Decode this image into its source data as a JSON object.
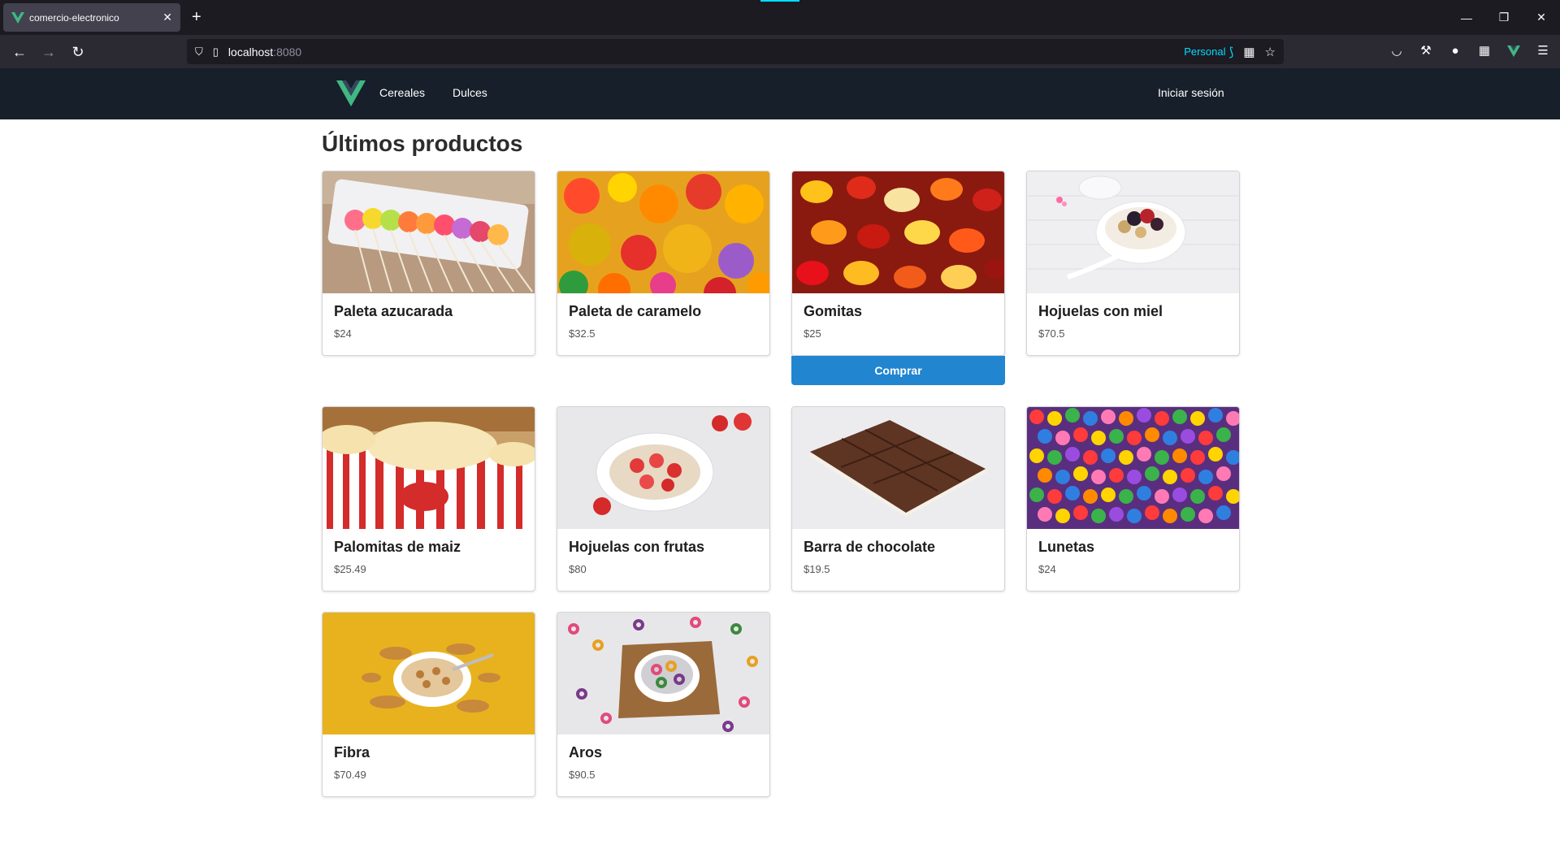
{
  "browser": {
    "tab_title": "comercio-electronico",
    "url_host": "localhost",
    "url_port": ":8080",
    "profile_label": "Personal",
    "icons": [
      "back-icon",
      "forward-icon",
      "reload-icon",
      "shield-icon",
      "page-icon",
      "container-icon",
      "grid-icon",
      "star-icon",
      "pocket-icon",
      "wrench-icon",
      "profile-icon",
      "extensions-icon",
      "vue-devtools-icon",
      "menu-icon"
    ],
    "colors": {
      "tab_bg": "#42414d",
      "accent": "#00ddff"
    }
  },
  "header": {
    "nav": [
      {
        "label": "Cereales"
      },
      {
        "label": "Dulces"
      }
    ],
    "login_label": "Iniciar sesión",
    "brand_colors": {
      "outer": "#41b883",
      "inner": "#35495e"
    }
  },
  "main": {
    "title": "Últimos productos",
    "buy_label": "Comprar",
    "products": [
      {
        "name": "Paleta azucarada",
        "price": "$24"
      },
      {
        "name": "Paleta de caramelo",
        "price": "$32.5"
      },
      {
        "name": "Gomitas",
        "price": "$25"
      },
      {
        "name": "Hojuelas con miel",
        "price": "$70.5"
      },
      {
        "name": "Palomitas de maiz",
        "price": "$25.49"
      },
      {
        "name": "Hojuelas con frutas",
        "price": "$80"
      },
      {
        "name": "Barra de chocolate",
        "price": "$19.5"
      },
      {
        "name": "Lunetas",
        "price": "$24"
      },
      {
        "name": "Fibra",
        "price": "$70.49"
      },
      {
        "name": "Aros",
        "price": "$90.5"
      }
    ]
  }
}
